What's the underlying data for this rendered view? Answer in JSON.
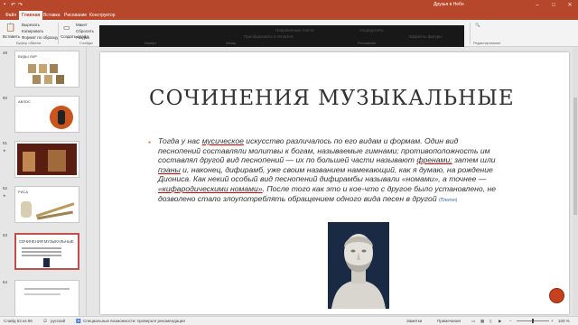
{
  "window": {
    "title": "Друзья в Небо",
    "tabs": [
      "Файл",
      "Главная",
      "Вставка",
      "Рисование",
      "Конструктор"
    ],
    "active_tab_index": 1
  },
  "ribbon": {
    "paste_label": "Вставить",
    "cut_label": "Вырезать",
    "copy_label": "Копировать",
    "format_painter_label": "Формат по образцу",
    "new_slide_label": "Создать слайд",
    "layout_label": "Макет",
    "reset_label": "Сбросить",
    "section_label": "Раздел",
    "text_direction_label": "Направление текста",
    "convert_smartart_label": "Преобразовать в SmartArt",
    "arrange_label": "Упорядочить",
    "shape_effects_label": "Эффекты фигуры",
    "groups": [
      "Буфер обмена",
      "Слайды",
      "Шрифт",
      "Абзац",
      "Рисование",
      "Редактирование"
    ]
  },
  "thumbnails": [
    {
      "num": "49",
      "title": "ВИДЫ ЛИР"
    },
    {
      "num": "50",
      "title": "АВЛОС"
    },
    {
      "num": "51",
      "title": ""
    },
    {
      "num": "52",
      "title": "РИСА"
    },
    {
      "num": "53",
      "title": "СОЧИНЕНИЯ МУЗЫКАЛЬНЫЕ"
    },
    {
      "num": "54",
      "title": ""
    }
  ],
  "selected_thumbnail": 4,
  "slide": {
    "title": "СОЧИНЕНИЯ МУЗЫКАЛЬНЫЕ",
    "body": {
      "p1": "Тогда у нас ",
      "u1": "мусическое",
      "p2": " искусство различалось по его видам и формам. Один вид песнопений составляли молитвы к богам, называемые гимнами; противоположность им составлял другой вид песнопений — их по большей части называют ",
      "u2": "френами;",
      "p3": " затем шли ",
      "u3": "пэаны",
      "p4": " и, наконец, дифирамб, уже своим названием намекающий, как я думаю, на рождение Диониса. Как некий особый вид песнопений дифирамбы называли «номами», а точнее — ",
      "u4": "«кифародическими номами»",
      "p5": ". После того как это и кое-что с другое было установлено, не дозволено стало злоупотреблять обращением одного вида песен в другой",
      "citation": "(Платон)"
    }
  },
  "status": {
    "slide_counter": "Слайд 53 из 86",
    "language": "русский",
    "accessibility": "Специальные возможности: проверьте рекомендации",
    "notes": "Заметки",
    "display": "Примечания",
    "zoom": "100 %"
  },
  "colors": {
    "accent": "#b7472a",
    "bullet": "#e0702a",
    "citation": "#2e5ea8",
    "nav_button": "#c8411e"
  }
}
